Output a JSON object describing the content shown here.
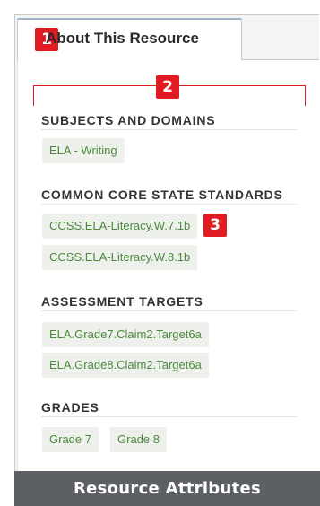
{
  "tab": {
    "label": "About This Resource"
  },
  "callouts": {
    "one": "1",
    "two": "2",
    "three": "3"
  },
  "sections": [
    {
      "heading": "SUBJECTS AND DOMAINS",
      "items": [
        "ELA - Writing"
      ]
    },
    {
      "heading": "COMMON CORE STATE STANDARDS",
      "items": [
        "CCSS.ELA-Literacy.W.7.1b",
        "CCSS.ELA-Literacy.W.8.1b"
      ]
    },
    {
      "heading": "ASSESSMENT TARGETS",
      "items": [
        "ELA.Grade7.Claim2.Target6a",
        "ELA.Grade8.Claim2.Target6a"
      ]
    },
    {
      "heading": "GRADES",
      "items": [
        "Grade 7",
        "Grade 8"
      ]
    }
  ],
  "caption": "Resource Attributes",
  "colors": {
    "accent_red": "#e11b22",
    "chip_text": "#4b8a3d",
    "chip_bg": "#eef0ec",
    "footer_bg": "#5c5f63"
  }
}
